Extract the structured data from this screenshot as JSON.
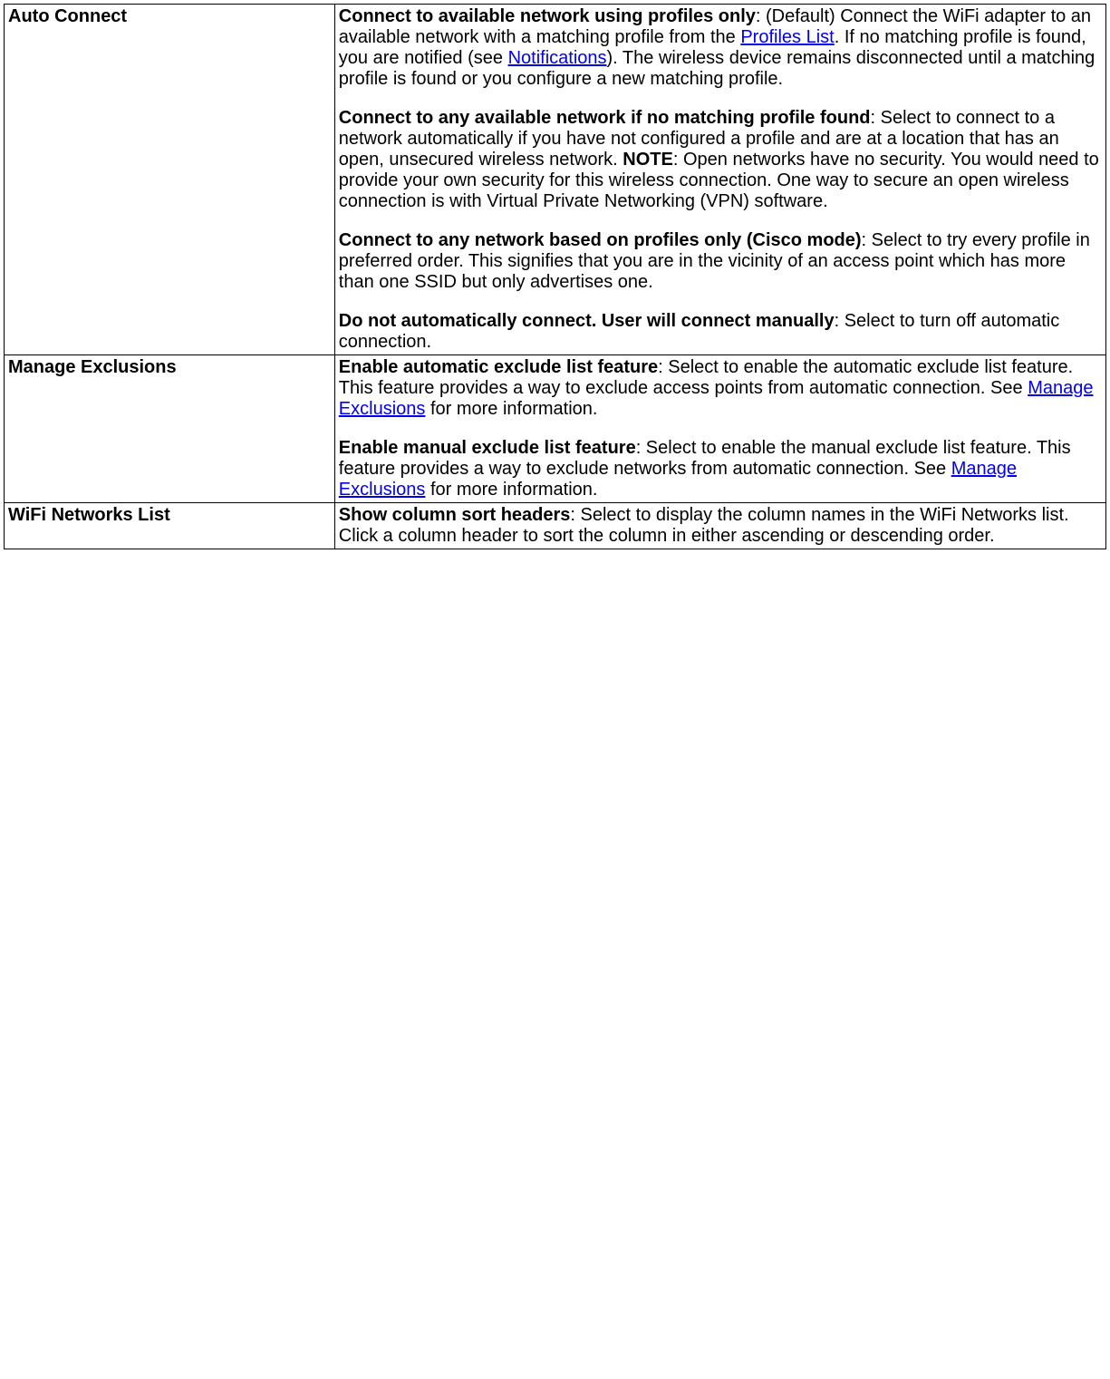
{
  "rows": [
    {
      "setting": "Auto Connect",
      "paras": [
        {
          "bold": "Connect to available network using profiles only",
          "text_a": ": (Default) Connect the WiFi adapter to an available network with a matching profile from the ",
          "link1": "Profiles List",
          "text_b": ". If no matching profile is found, you are notified (see ",
          "link2": "Notifications",
          "text_c": "). The wireless device remains disconnected until a matching profile is found or you configure a new matching profile."
        },
        {
          "bold": "Connect to any available network if no matching profile found",
          "text_a": ": Select to connect to a network automatically if you have not configured a profile and are at a location that has an open, unsecured wireless network. ",
          "bold2": "NOTE",
          "text_b": ": Open networks have no security. You would need to provide your own security for this wireless connection. One way to secure an open wireless connection is with Virtual Private Networking (VPN) software."
        },
        {
          "bold": "Connect to any network based on profiles only (Cisco mode)",
          "text_a": ": Select to try every profile in preferred order. This signifies that you are in the vicinity of an access point which has more than one SSID but only advertises one."
        },
        {
          "bold": "Do not automatically connect. User will connect manually",
          "text_a": ": Select to turn off automatic connection."
        }
      ]
    },
    {
      "setting": "Manage Exclusions",
      "paras": [
        {
          "bold": "Enable automatic exclude list feature",
          "text_a": ": Select to enable the automatic exclude list feature. This feature provides a way to exclude access points from automatic connection. See ",
          "link1": "Manage Exclusions",
          "text_b": " for more information."
        },
        {
          "bold": "Enable manual exclude list feature",
          "text_a": ": Select to enable the manual exclude list feature. This feature provides a way to exclude networks from automatic connection. See ",
          "link1": "Manage Exclusions",
          "text_b": " for more information."
        }
      ]
    },
    {
      "setting": "WiFi Networks List",
      "paras": [
        {
          "bold": "Show column sort headers",
          "text_a": ": Select to display the column names in the WiFi Networks list. Click a column header to sort the column in either ascending or descending order."
        }
      ]
    }
  ]
}
